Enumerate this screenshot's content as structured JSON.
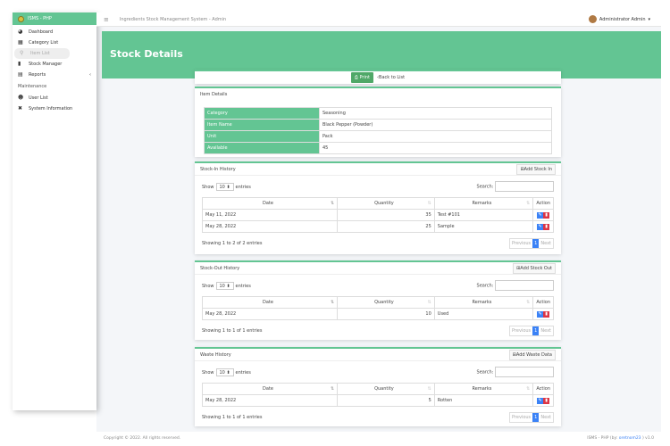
{
  "brand": {
    "name": "ISMS - PHP"
  },
  "sidebar": {
    "items": [
      {
        "label": "Dashboard",
        "icon": "dashboard-icon",
        "glyph": "◕"
      },
      {
        "label": "Category List",
        "icon": "list-icon",
        "glyph": "▦"
      },
      {
        "label": "Item List",
        "icon": "item-icon",
        "glyph": "⚲"
      },
      {
        "label": "Stock Manager",
        "icon": "stock-icon",
        "glyph": "▮"
      },
      {
        "label": "Reports",
        "icon": "table-icon",
        "glyph": "▤"
      }
    ],
    "section": "Maintenance",
    "maint_items": [
      {
        "label": "User List",
        "icon": "users-icon",
        "glyph": "☻"
      },
      {
        "label": "System Information",
        "icon": "tools-icon",
        "glyph": "✖"
      }
    ]
  },
  "navbar": {
    "title": "Ingredients Stock Management System - Admin",
    "user": "Administrator Admin"
  },
  "page": {
    "title": "Stock Details",
    "print": "Print",
    "back": "Back to List"
  },
  "item_details": {
    "title": "Item Details",
    "rows": [
      [
        "Category",
        "Seasoning"
      ],
      [
        "Item Name",
        "Black Pepper (Powder)"
      ],
      [
        "Unit",
        "Pack"
      ],
      [
        "Available",
        "45"
      ]
    ]
  },
  "common": {
    "show": "Show",
    "entries": "entries",
    "length": "10",
    "search": "Search:",
    "headers": [
      "Date",
      "Quantity",
      "Remarks",
      "Action"
    ],
    "prev": "Previous",
    "page": "1",
    "next": "Next"
  },
  "stock_in": {
    "title": "Stock-In History",
    "add": "Add Stock In",
    "rows": [
      [
        "May 11, 2022",
        "35",
        "Test #101"
      ],
      [
        "May 28, 2022",
        "25",
        "Sample"
      ]
    ],
    "info": "Showing 1 to 2 of 2 entries"
  },
  "stock_out": {
    "title": "Stock-Out History",
    "add": "Add Stock Out",
    "rows": [
      [
        "May 28, 2022",
        "10",
        "Used"
      ]
    ],
    "info": "Showing 1 to 1 of 1 entries"
  },
  "waste": {
    "title": "Waste History",
    "add": "Add Waste Data",
    "rows": [
      [
        "May 28, 2022",
        "5",
        "Rotten"
      ]
    ],
    "info": "Showing 1 to 1 of 1 entries"
  },
  "footer": {
    "copyright": "Copyright © 2022. All rights reserved.",
    "credit_prefix": "ISMS - PHP (by: ",
    "author": "oretnom23",
    "credit_suffix": " ) v1.0"
  },
  "colors": {
    "accent": "#63c593",
    "primary": "#3b82f6",
    "danger": "#dc3545"
  }
}
